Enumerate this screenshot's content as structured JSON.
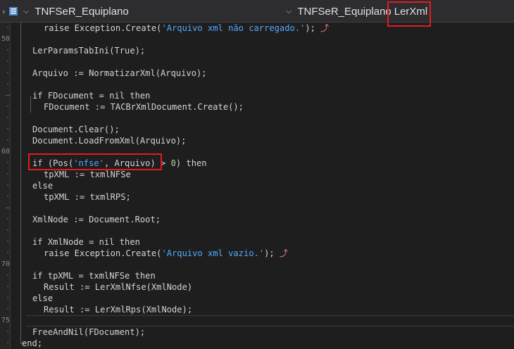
{
  "toolbar": {
    "unit_name": "TNFSeR_Equiplano",
    "scope_class": "TNFSeR_Equiplano",
    "scope_method": "LerXml"
  },
  "gutter": {
    "line_60": "60",
    "line_70": "70",
    "line_75": "75",
    "line_50": "50"
  },
  "code": {
    "l1a": "raise Exception.Create(",
    "l1s": "'Arquivo xml não carregado.'",
    "l1b": ");",
    "l2": "LerParamsTabIni(True);",
    "l3": "Arquivo := NormatizarXml(Arquivo);",
    "l4": "if FDocument = nil then",
    "l5": "FDocument := TACBrXmlDocument.Create();",
    "l6": "Document.Clear();",
    "l7": "Document.LoadFromXml(Arquivo);",
    "l8a": "if (Pos(",
    "l8s": "'nfse'",
    "l8b": ", Arquivo) > ",
    "l8n": "0",
    "l8c": ") then",
    "l9": "tpXML := txmlNFSe",
    "l10": "else",
    "l11": "tpXML := txmlRPS;",
    "l12": "XmlNode := Document.Root;",
    "l13": "if XmlNode = nil then",
    "l14a": "raise Exception.Create(",
    "l14s": "'Arquivo xml vazio.'",
    "l14b": ");",
    "l15": "if tpXML = txmlNFSe then",
    "l16": "Result := LerXmlNfse(XmlNode)",
    "l17": "else",
    "l18": "Result := LerXmlRps(XmlNode);",
    "l19": "FreeAndNil(FDocument);",
    "l20": "end;"
  },
  "colors": {
    "background": "#1e1e1e",
    "string": "#52a8ff",
    "number": "#b5cea8",
    "highlight_box": "#e11b22"
  }
}
